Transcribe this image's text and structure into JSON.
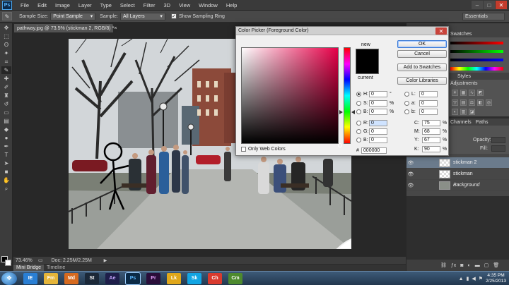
{
  "app": {
    "logo": "Ps"
  },
  "menu": [
    "File",
    "Edit",
    "Image",
    "Layer",
    "Type",
    "Select",
    "Filter",
    "3D",
    "View",
    "Window",
    "Help"
  ],
  "window_buttons": [
    "–",
    "□",
    "✕"
  ],
  "options": {
    "sample_size_label": "Sample Size:",
    "sample_size_value": "Point Sample",
    "sample_label": "Sample:",
    "sample_value": "All Layers",
    "show_ring_label": "Show Sampling Ring",
    "workspace": "Essentials"
  },
  "document": {
    "tab_title": "pathway.jpg @ 73.5% (stickman 2, RGB/8) *",
    "zoom": "73.46%",
    "doc_info": "Doc: 2.25M/2.25M"
  },
  "bottom_tabs": [
    "Mini Bridge",
    "Timeline"
  ],
  "panels": {
    "swatches_tab": "Swatches",
    "styles_tab": "Styles",
    "adjustments_tab": "Adjustments",
    "channels_tab": "Channels",
    "paths_tab": "Paths",
    "opacity_label": "Opacity:",
    "fill_label": "Fill:",
    "layers": [
      {
        "name": "stickman 2",
        "selected": true,
        "background": false
      },
      {
        "name": "stickman",
        "selected": false,
        "background": false
      },
      {
        "name": "Background",
        "selected": false,
        "background": true
      }
    ]
  },
  "color_picker": {
    "title": "Color Picker (Foreground Color)",
    "close": "✕",
    "new_label": "new",
    "current_label": "current",
    "ok": "OK",
    "cancel": "Cancel",
    "add_to_swatches": "Add to Swatches",
    "color_libraries": "Color Libraries",
    "fields": {
      "H": {
        "value": "0",
        "unit": "°"
      },
      "S": {
        "value": "0",
        "unit": "%"
      },
      "B": {
        "value": "0",
        "unit": "%"
      },
      "R": {
        "value": "0"
      },
      "G": {
        "value": "0"
      },
      "Bl": {
        "value": "0"
      },
      "L": {
        "value": "0"
      },
      "a": {
        "value": "0"
      },
      "b": {
        "value": "0"
      },
      "C": {
        "value": "75",
        "unit": "%"
      },
      "M": {
        "value": "68",
        "unit": "%"
      },
      "Y": {
        "value": "67",
        "unit": "%"
      },
      "K": {
        "value": "90",
        "unit": "%"
      }
    },
    "hex_label": "#",
    "hex": "000000",
    "only_web_colors": "Only Web Colors"
  },
  "taskbar": {
    "apps": [
      "IE",
      "Fm",
      "Md",
      "St",
      "Ae",
      "Ps",
      "Pr",
      "Lk",
      "Sk",
      "Ch",
      "Cm"
    ],
    "time": "4:35 PM",
    "date": "2/25/2013"
  }
}
